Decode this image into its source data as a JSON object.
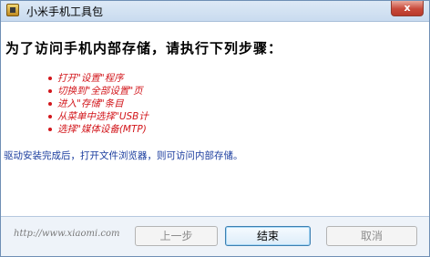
{
  "window": {
    "title": "小米手机工具包",
    "close_glyph": "x"
  },
  "main": {
    "heading": "为了访问手机内部存储，请执行下列步骤：",
    "steps": [
      "打开\"设置\"程序",
      "切换到\"全部设置\"页",
      "进入\"存储\"条目",
      "从菜单中选择\"USB计",
      "选择\"媒体设备(MTP)"
    ],
    "note": "驱动安装完成后，打开文件浏览器，则可访问内部存储。"
  },
  "footer": {
    "url": "http://www.xiaomi.com",
    "prev_label": "上一步",
    "finish_label": "结束",
    "cancel_label": "取消"
  },
  "colors": {
    "step_text": "#d2161b",
    "note_text": "#1a3c9e",
    "window_border": "#6f8fb5",
    "close_button": "#c8493a"
  }
}
